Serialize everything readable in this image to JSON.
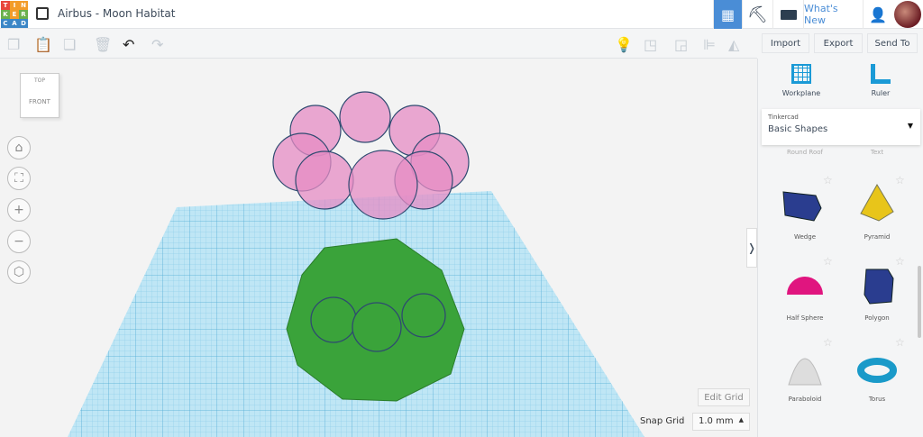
{
  "header": {
    "logo_letters": [
      "T",
      "I",
      "N",
      "K",
      "E",
      "R",
      "C",
      "A",
      "D"
    ],
    "logo_colors": [
      "#e8473c",
      "#f39c29",
      "#f39c29",
      "#6ab04c",
      "#f39c29",
      "#6ab04c",
      "#3b86c6",
      "#3b86c6",
      "#3b86c6"
    ],
    "title": "Airbus - Moon Habitat",
    "whats_new": "What's New"
  },
  "toolbar": {
    "import": "Import",
    "export": "Export",
    "send_to": "Send To"
  },
  "viewcube": {
    "top": "TOP",
    "front": "FRONT"
  },
  "sidebar": {
    "workplane": "Workplane",
    "ruler": "Ruler",
    "library_label": "Tinkercad",
    "library_value": "Basic Shapes",
    "partial": [
      "Round Roof",
      "Text"
    ],
    "shapes": [
      {
        "label": "Wedge",
        "color": "#2a3d8f"
      },
      {
        "label": "Pyramid",
        "color": "#e8c51a"
      },
      {
        "label": "Half Sphere",
        "color": "#e0157f"
      },
      {
        "label": "Polygon",
        "color": "#2a3d8f"
      },
      {
        "label": "Paraboloid",
        "color": "#dddddd"
      },
      {
        "label": "Torus",
        "color": "#1a9ac9"
      }
    ]
  },
  "footer": {
    "edit_grid": "Edit Grid",
    "snap_grid_label": "Snap Grid",
    "snap_grid_value": "1.0 mm"
  }
}
